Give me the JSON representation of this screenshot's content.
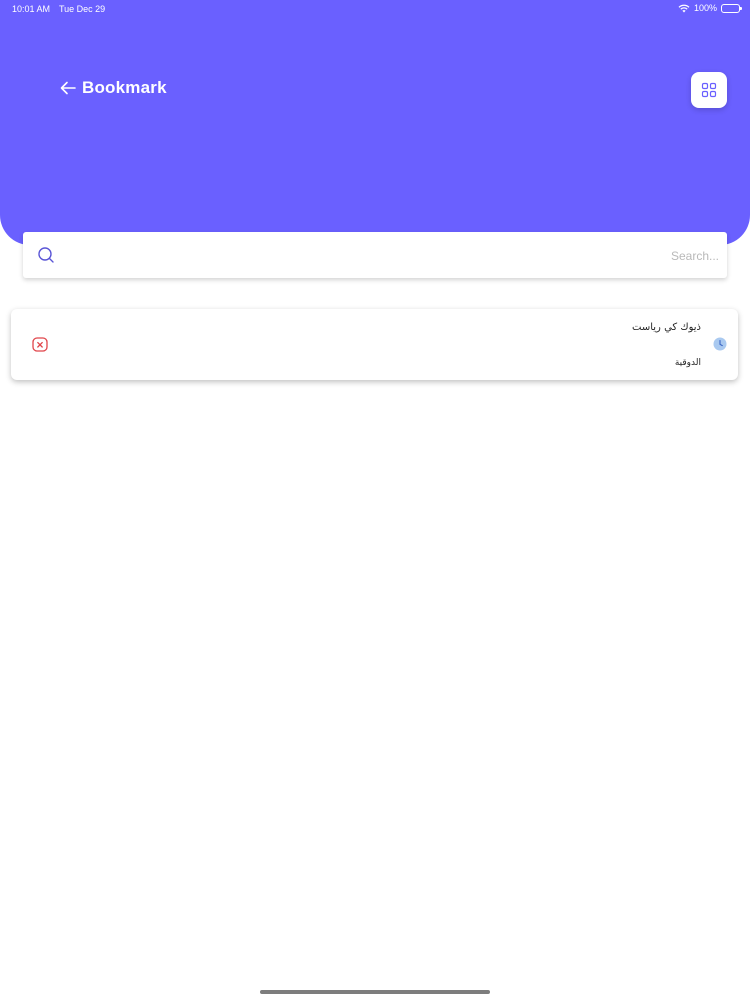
{
  "status_bar": {
    "time": "10:01 AM",
    "date": "Tue Dec 29",
    "battery": "100%"
  },
  "header": {
    "title": "Bookmark",
    "back_icon": "arrow-left-icon",
    "menu_icon": "grid-icon",
    "background_color": "#6a60ff"
  },
  "search": {
    "placeholder": "Search...",
    "value": "",
    "icon": "search-icon"
  },
  "bookmarks": [
    {
      "title": "ذيوك كي رياست",
      "subtitle": "الدوقية",
      "remove_icon": "remove-icon",
      "status_icon": "clock-icon"
    }
  ]
}
